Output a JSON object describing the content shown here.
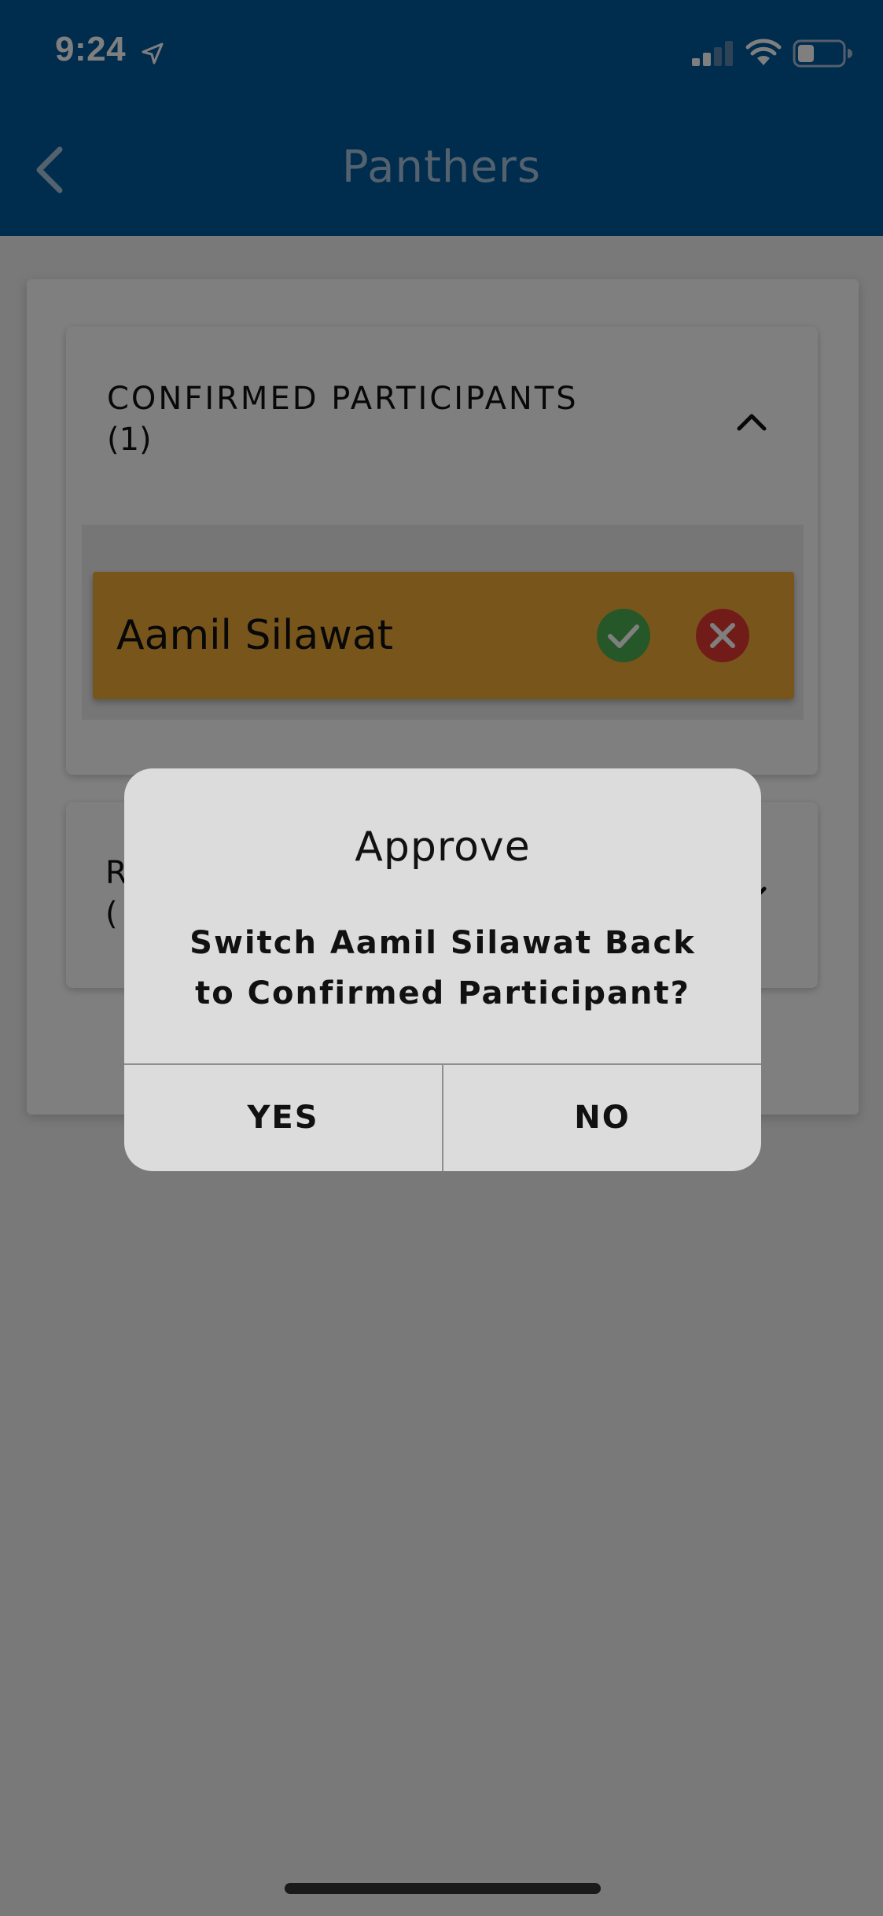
{
  "status_bar": {
    "time": "9:24",
    "location_icon": "location-arrow-icon",
    "signal_icon": "cellular-signal-icon",
    "wifi_icon": "wifi-icon",
    "battery_icon": "battery-icon"
  },
  "header": {
    "title": "Panthers",
    "back_icon": "chevron-left-icon",
    "background_color": "#01589d"
  },
  "confirmed_section": {
    "heading": "CONFIRMED PARTICIPANTS",
    "count": "(1)",
    "chevron_icon": "chevron-up-icon",
    "participants": [
      {
        "name": "Aamil Silawat",
        "approve_icon": "check-circle-icon",
        "reject_icon": "x-circle-icon",
        "row_color": "#f0ac36"
      }
    ]
  },
  "second_section": {
    "heading_initial": "R",
    "count_initial": "(",
    "chevron_icon": "chevron-down-icon"
  },
  "dialog": {
    "title": "Approve",
    "message": "Switch Aamil Silawat Back to Confirmed Participant?",
    "yes_label": "YES",
    "no_label": "NO"
  },
  "colors": {
    "approve_green": "#4caf50",
    "reject_red": "#e53935"
  }
}
